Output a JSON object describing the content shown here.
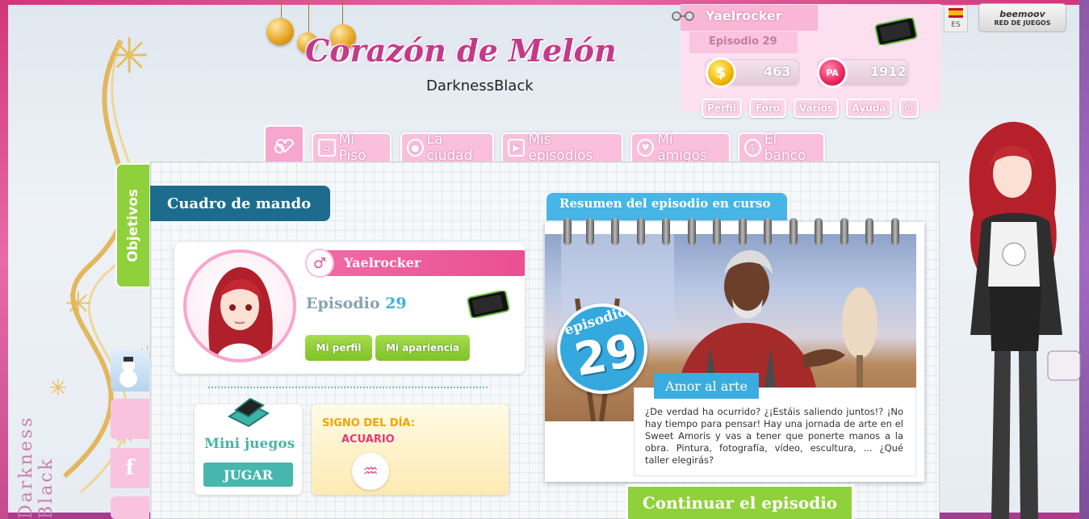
{
  "logo": {
    "title": "Corazón de Melón",
    "subtitle": "DarknessBlack"
  },
  "signature": "Darkness Black",
  "user": {
    "name": "Yaelrocker",
    "episode_label": "Episodio 29",
    "coins": "463",
    "action_points": "1912"
  },
  "user_menu": {
    "profile": "Perfil",
    "forum": "Foro",
    "misc": "Varios",
    "help": "Ayuda"
  },
  "lang": {
    "code": "ES"
  },
  "network": {
    "logo": "beemoov",
    "label": "RED DE JUEGOS"
  },
  "nav": [
    {
      "label": "Mi Piso",
      "icon": "house-icon"
    },
    {
      "label": "La ciudad",
      "icon": "location-pin-icon"
    },
    {
      "label": "Mis episodios",
      "icon": "play-icon"
    },
    {
      "label": "Mi amigos",
      "icon": "heart-icon"
    },
    {
      "label": "El banco",
      "icon": "dollar-icon"
    }
  ],
  "side": {
    "objectives": "Objetivos",
    "facebook": "f"
  },
  "dashboard": {
    "title": "Cuadro de mando",
    "profile": {
      "name": "Yaelrocker",
      "episode_word": "Episodio",
      "episode_num": "29",
      "btn_profile": "Mi perfil",
      "btn_appearance": "Mi apariencia"
    },
    "minigames": {
      "title": "Mini juegos",
      "button": "JUGAR"
    },
    "sign": {
      "title": "SIGNO DEL DÍA:",
      "value": "ACUARIO"
    }
  },
  "episode_summary": {
    "tab": "Resumen del episodio en curso",
    "badge_label": "episodio",
    "badge_num": "29",
    "title": "Amor al arte",
    "description": "¿De verdad ha ocurrido? ¿¡Estáis saliendo juntos!? ¡No hay tiempo para pensar! Hay una jornada de arte en el Sweet Amoris y vas a tener que ponerte manos a la obra. Pintura, fotografía, vídeo, escultura, ... ¿Qué taller elegirás?",
    "continue": "Continuar el episodio"
  },
  "colors": {
    "pink": "#f9bfdc",
    "green": "#8fd13a",
    "blue": "#47b6e6",
    "navy": "#1d6c8e"
  }
}
